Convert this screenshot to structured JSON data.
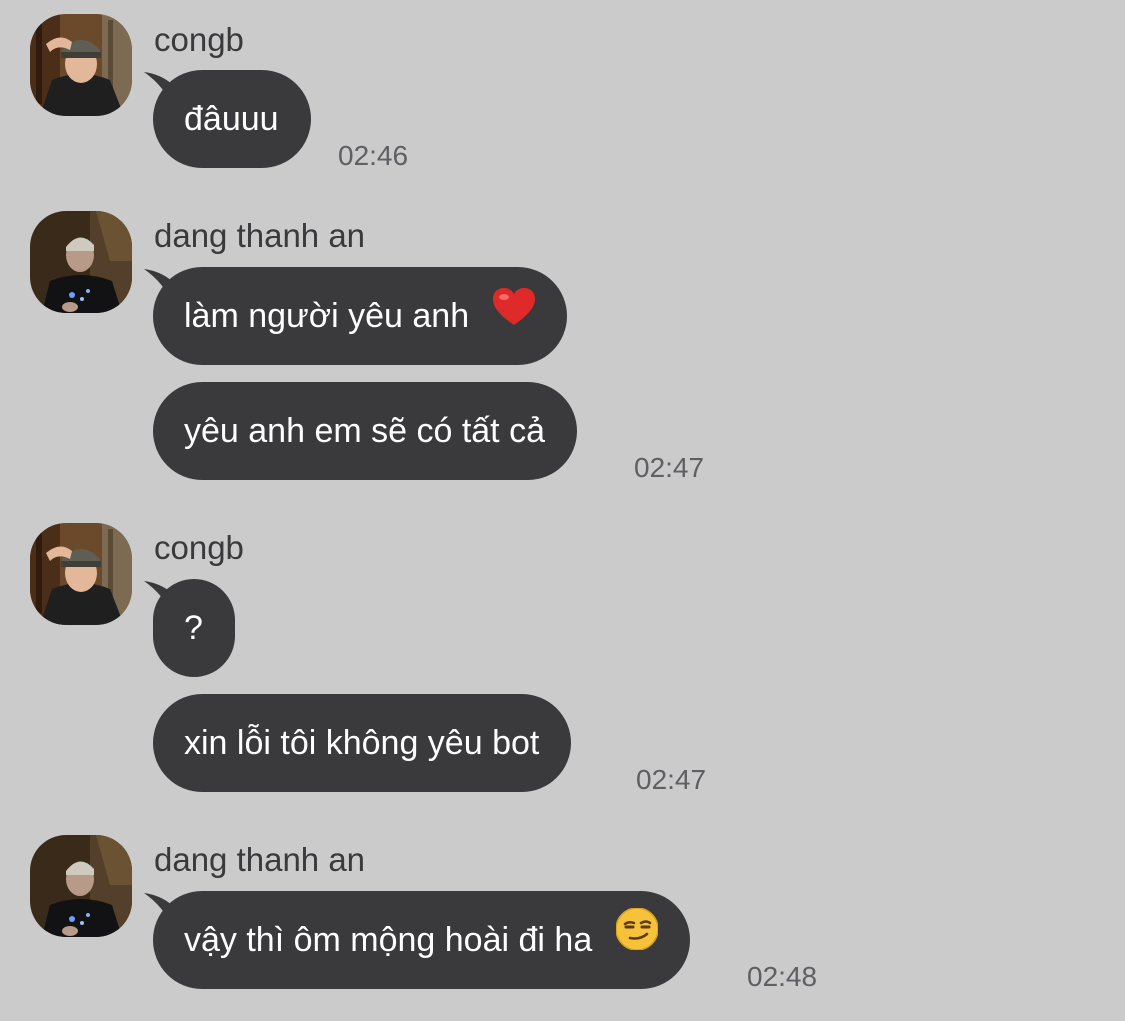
{
  "groups": [
    {
      "sender": "congb",
      "avatar_icon": "avatar-congb",
      "messages": [
        {
          "text": "đâuuu"
        }
      ],
      "time": "02:46"
    },
    {
      "sender": "dang thanh an",
      "avatar_icon": "avatar-dang-thanh-an",
      "messages": [
        {
          "text": "làm người yêu anh",
          "emoji": "red-heart-emoji"
        },
        {
          "text": "yêu anh em sẽ có tất cả"
        }
      ],
      "time": "02:47"
    },
    {
      "sender": "congb",
      "avatar_icon": "avatar-congb",
      "messages": [
        {
          "text": "?"
        },
        {
          "text": "xin lỗi tôi không yêu bot"
        }
      ],
      "time": "02:47"
    },
    {
      "sender": "dang thanh an",
      "avatar_icon": "avatar-dang-thanh-an",
      "messages": [
        {
          "text": "vậy thì ôm mộng hoài đi ha",
          "emoji": "smirking-face-emoji"
        }
      ],
      "time": "02:48"
    }
  ],
  "colors": {
    "background": "#cbcbcb",
    "bubble": "#3a3a3c",
    "bubble_text": "#ffffff",
    "sender_text": "#3a3a3c",
    "time_text": "#5f5f63"
  }
}
